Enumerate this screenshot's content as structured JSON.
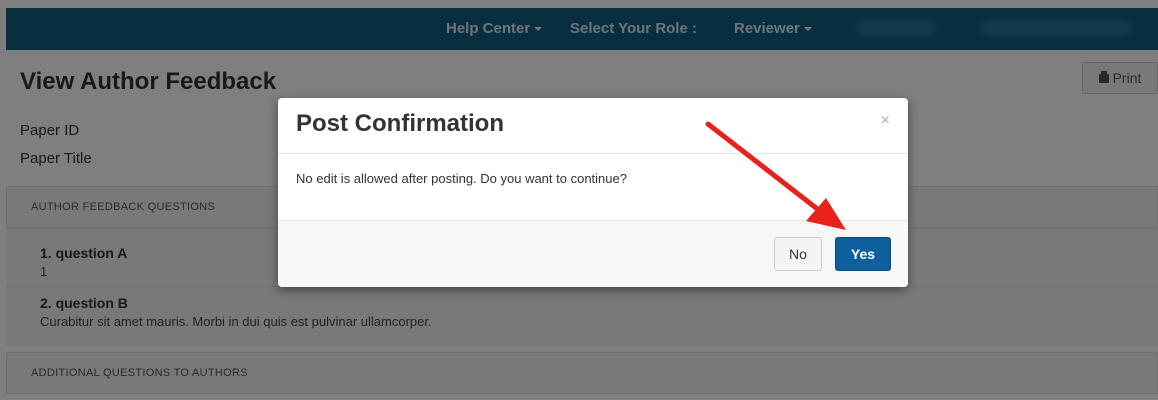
{
  "navbar": {
    "help_center": "Help Center",
    "select_role_label": "Select Your Role :",
    "role_value": "Reviewer"
  },
  "page": {
    "title": "View Author Feedback",
    "print_label": "Print",
    "paper_id_label": "Paper ID",
    "paper_title_label": "Paper Title"
  },
  "sections": {
    "author_feedback_header": "AUTHOR FEEDBACK QUESTIONS",
    "additional_questions_header": "ADDITIONAL QUESTIONS TO AUTHORS"
  },
  "questions": [
    {
      "title": "1. question A",
      "answer": "1"
    },
    {
      "title": "2. question B",
      "answer": "Curabitur sit amet mauris. Morbi in dui quis est pulvinar ullamcorper."
    }
  ],
  "modal": {
    "title": "Post Confirmation",
    "close": "×",
    "message": "No edit is allowed after posting. Do you want to continue?",
    "no_label": "No",
    "yes_label": "Yes"
  },
  "colors": {
    "navbar": "#0f5f80",
    "primary_button": "#0e5f9d",
    "arrow": "#e8221a"
  },
  "icons": {
    "print": "print-icon",
    "close": "close-icon",
    "caret": "caret-down-icon"
  }
}
